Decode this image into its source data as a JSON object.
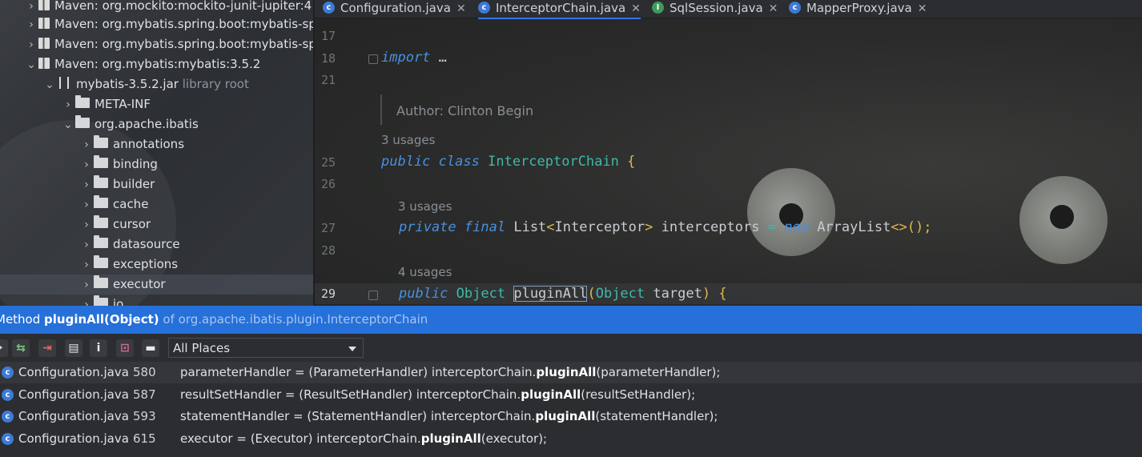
{
  "tree": {
    "items": [
      {
        "label": "Maven: org.mockito:mockito-junit-jupiter:4",
        "expanded": false
      },
      {
        "label": "Maven: org.mybatis.spring.boot:mybatis-sp",
        "expanded": false
      },
      {
        "label": "Maven: org.mybatis.spring.boot:mybatis-sp",
        "expanded": false
      },
      {
        "label": "Maven: org.mybatis:mybatis:3.5.2",
        "expanded": true
      },
      {
        "label": "mybatis-3.5.2.jar",
        "suffix": "library root",
        "expanded": true
      },
      {
        "label": "META-INF",
        "expanded": false
      },
      {
        "label": "org.apache.ibatis",
        "expanded": true
      },
      {
        "label": "annotations",
        "expanded": false
      },
      {
        "label": "binding",
        "expanded": false
      },
      {
        "label": "builder",
        "expanded": false
      },
      {
        "label": "cache",
        "expanded": false
      },
      {
        "label": "cursor",
        "expanded": false
      },
      {
        "label": "datasource",
        "expanded": false
      },
      {
        "label": "exceptions",
        "expanded": false
      },
      {
        "label": "executor",
        "expanded": false
      },
      {
        "label": "io",
        "expanded": false
      }
    ]
  },
  "tabs": [
    {
      "label": "Configuration.java",
      "icon": "C",
      "active": false
    },
    {
      "label": "InterceptorChain.java",
      "icon": "C",
      "active": true
    },
    {
      "label": "SqlSession.java",
      "icon": "I",
      "active": false
    },
    {
      "label": "MapperProxy.java",
      "icon": "C",
      "active": false
    }
  ],
  "editor": {
    "line_numbers": [
      "17",
      "18",
      "21",
      "25",
      "26",
      "27",
      "28",
      "29"
    ],
    "import_kw": "import",
    "import_dots": "…",
    "author_hint": "Author: Clinton Begin",
    "class_usages": "3 usages",
    "field_usages": "3 usages",
    "method_usages": "4 usages",
    "line25": {
      "kw1": "public",
      "kw2": "class",
      "name": "InterceptorChain",
      "brace": "{"
    },
    "line27": {
      "kw1": "private",
      "kw2": "final",
      "type": "List",
      "lt": "<",
      "generic": "Interceptor",
      "gt": ">",
      "var": "interceptors",
      "eq": "=",
      "kw3": "new",
      "ctor": "ArrayList",
      "diamond": "<>",
      "end": "();"
    },
    "line29": {
      "kw1": "public",
      "ret": "Object",
      "method": "pluginAll",
      "open": "(",
      "ptype": "Object",
      "pname": "target",
      "close": ")",
      "brace": "{"
    }
  },
  "popup": {
    "title_prefix": "Method",
    "title_method": "pluginAll(Object)",
    "title_location": "of org.apache.ibatis.plugin.InterceptorChain",
    "scope": "All Places",
    "usages": [
      {
        "file": "Configuration.java",
        "line": "580",
        "pre": "parameterHandler = (ParameterHandler) interceptorChain.",
        "bold": "pluginAll",
        "post": "(parameterHandler);"
      },
      {
        "file": "Configuration.java",
        "line": "587",
        "pre": "resultSetHandler = (ResultSetHandler) interceptorChain.",
        "bold": "pluginAll",
        "post": "(resultSetHandler);"
      },
      {
        "file": "Configuration.java",
        "line": "593",
        "pre": "statementHandler = (StatementHandler) interceptorChain.",
        "bold": "pluginAll",
        "post": "(statementHandler);"
      },
      {
        "file": "Configuration.java",
        "line": "615",
        "pre": "executor = (Executor) interceptorChain.",
        "bold": "pluginAll",
        "post": "(executor);"
      }
    ]
  }
}
